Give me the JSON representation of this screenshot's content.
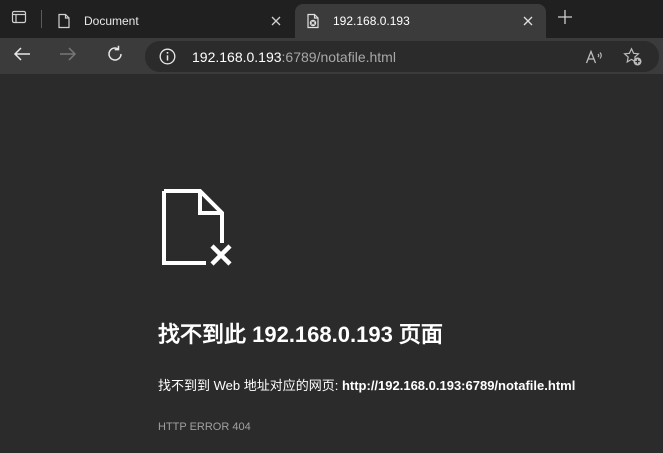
{
  "tabs": [
    {
      "title": "Document",
      "icon": "document-icon",
      "active": false
    },
    {
      "title": "192.168.0.193",
      "icon": "broken-page-icon",
      "active": true
    }
  ],
  "toolbar": {
    "url_host": "192.168.0.193",
    "url_rest": ":6789/notafile.html"
  },
  "error": {
    "title": "找不到此 192.168.0.193 页面",
    "desc_prefix": "找不到到 Web 地址对应的网页: ",
    "desc_url": "http://192.168.0.193:6789/notafile.html",
    "code": "HTTP ERROR 404"
  },
  "colors": {
    "tabstrip_bg": "#202020",
    "toolbar_bg": "#3b3b3b",
    "page_bg": "#2b2b2b",
    "text": "#ffffff",
    "muted": "#a0a0a0"
  }
}
